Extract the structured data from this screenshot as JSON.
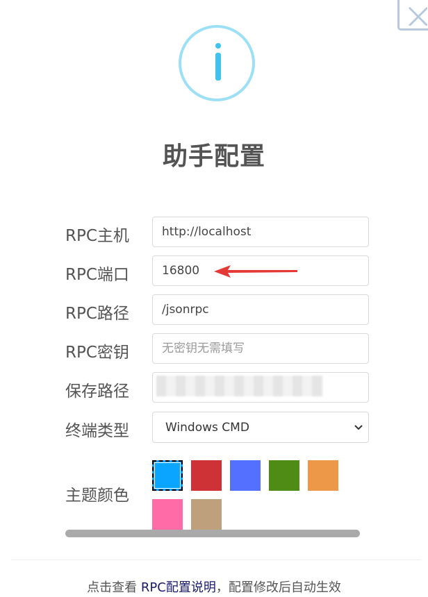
{
  "dialog": {
    "title": "助手配置",
    "icon": "info-icon",
    "close_icon": "close-icon"
  },
  "form": {
    "host": {
      "label": "RPC主机",
      "value": "http://localhost"
    },
    "port": {
      "label": "RPC端口",
      "value": "16800"
    },
    "path": {
      "label": "RPC路径",
      "value": "/jsonrpc"
    },
    "secret": {
      "label": "RPC密钥",
      "value": "",
      "placeholder": "无密钥无需填写"
    },
    "save_path": {
      "label": "保存路径",
      "value": ""
    },
    "terminal": {
      "label": "终端类型",
      "selected": "Windows CMD"
    },
    "theme": {
      "label": "主题颜色",
      "colors": [
        "#0aa5ff",
        "#cf3236",
        "#5470ff",
        "#4e8c16",
        "#ed9749",
        "#fe6ba6",
        "#bea07c"
      ],
      "selected_index": 0
    }
  },
  "footer": {
    "prefix": "点击查看 ",
    "link": "RPC配置说明",
    "suffix": "，配置修改后自动生效"
  },
  "annotation": {
    "arrow_color": "#e53935"
  }
}
